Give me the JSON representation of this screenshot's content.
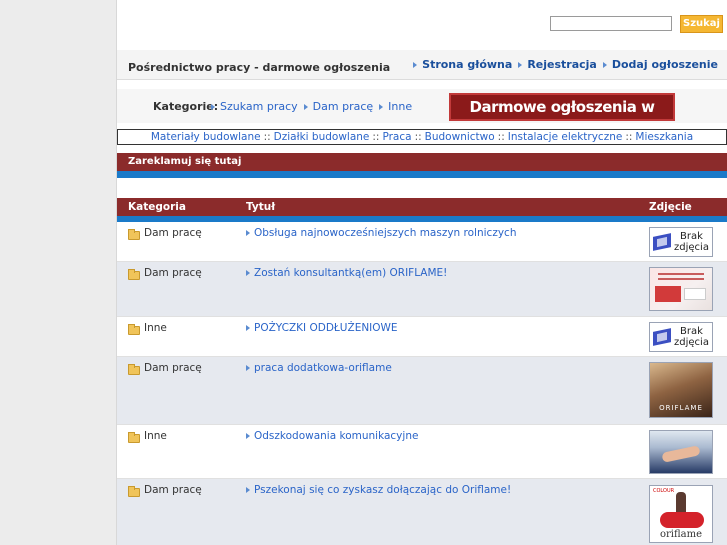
{
  "search": {
    "placeholder": "",
    "button_label": "Szukaj"
  },
  "header": {
    "site_title": "Pośrednictwo pracy - darmowe ogłoszenia"
  },
  "top_nav": [
    {
      "label": "Strona główna"
    },
    {
      "label": "Rejestracja"
    },
    {
      "label": "Dodaj ogłoszenie"
    }
  ],
  "categories": {
    "label": "Kategorie:",
    "items": [
      {
        "label": "Szukam pracy"
      },
      {
        "label": "Dam pracę"
      },
      {
        "label": "Inne"
      }
    ],
    "banner": "Darmowe ogłoszenia w sieci !!"
  },
  "related": {
    "items": [
      "Materiały budowlane",
      "Działki budowlane",
      "Praca",
      "Budownictwo",
      "Instalacje elektryczne",
      "Mieszkania"
    ],
    "separator": "::"
  },
  "ad_bar": {
    "label": "Zareklamuj się tutaj"
  },
  "table": {
    "headers": {
      "category": "Kategoria",
      "title": "Tytuł",
      "photo": "Zdjęcie"
    },
    "rows": [
      {
        "category": "Dam pracę",
        "title": "Obsługa najnowocześniejszych maszyn rolniczych",
        "photo": "no-photo",
        "photo_text_1": "Brak",
        "photo_text_2": "zdjęcia"
      },
      {
        "category": "Dam pracę",
        "title": "Zostań konsultantką(em) ORIFLAME!",
        "photo": "oriflame-flyer"
      },
      {
        "category": "Inne",
        "title": "POŻYCZKI ODDŁUŻENIOWE",
        "photo": "no-photo",
        "photo_text_1": "Brak",
        "photo_text_2": "zdjęcia"
      },
      {
        "category": "Dam pracę",
        "title": "praca dodatkowa-oriflame",
        "photo": "oriflame-portrait",
        "photo_label": "ORIFLAME"
      },
      {
        "category": "Inne",
        "title": "Odszkodowania komunikacyjne",
        "photo": "handshake"
      },
      {
        "category": "Dam pracę",
        "title": "Pszekonaj się co zyskasz dołączając do Oriflame!",
        "photo": "oriflame-colour",
        "photo_label": "oriflame",
        "photo_top": "COLOUR"
      }
    ]
  },
  "colors": {
    "header_bar": "#8b2b2b",
    "accent_blue": "#1a7ac9",
    "link": "#2a64c8",
    "search_button": "#f5b732",
    "banner": "#8b1a1a"
  }
}
